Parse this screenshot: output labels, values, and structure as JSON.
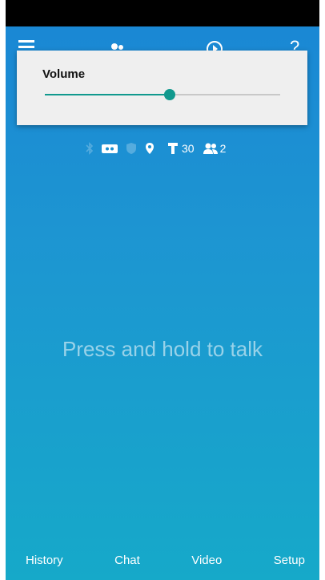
{
  "volume": {
    "title": "Volume",
    "level": 0.53
  },
  "indicators": {
    "talk_count": "30",
    "users_count": "2"
  },
  "main": {
    "ptt_text": "Press and hold to talk"
  },
  "bottom_nav": {
    "history": "History",
    "chat": "Chat",
    "video": "Video",
    "setup": "Setup"
  },
  "icons": [
    "menu-icon",
    "contacts-icon",
    "play-icon",
    "help-icon",
    "bluetooth-icon",
    "record-icon",
    "shield-icon",
    "location-icon",
    "talk-icon",
    "users-icon"
  ],
  "colors": {
    "accent": "#11998e",
    "background_top": "#1a86d4",
    "background_bottom": "#16a9c9"
  }
}
